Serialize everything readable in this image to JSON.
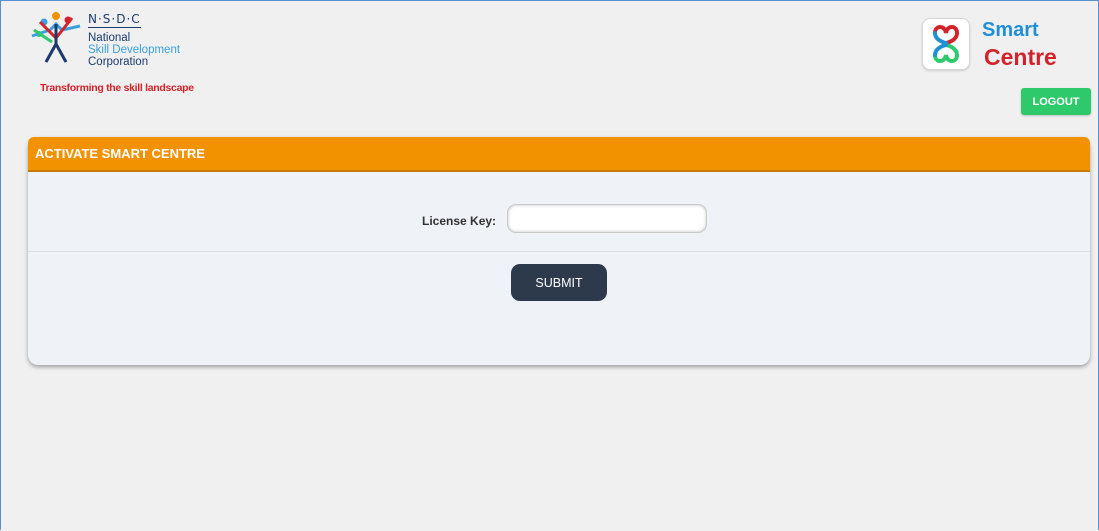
{
  "header": {
    "nsdc": {
      "abbr": "N·S·D·C",
      "line1": "National",
      "line2": "Skill Development",
      "line3": "Corporation",
      "tagline": "Transforming the skill landscape",
      "icon": "nsdc-people-icon"
    },
    "smart_centre": {
      "word1": "Smart",
      "word2": "Centre",
      "icon": "knot-icon"
    },
    "logout_label": "LOGOUT"
  },
  "panel": {
    "title": "ACTIVATE SMART CENTRE",
    "license_label": "License Key:",
    "license_value": "",
    "license_placeholder": "",
    "submit_label": "SUBMIT"
  },
  "colors": {
    "header_orange": "#f39200",
    "logout_green": "#2ec96b",
    "submit_dark": "#2c3a4c",
    "brand_blue": "#1f8fd6",
    "brand_red": "#d2232a"
  }
}
